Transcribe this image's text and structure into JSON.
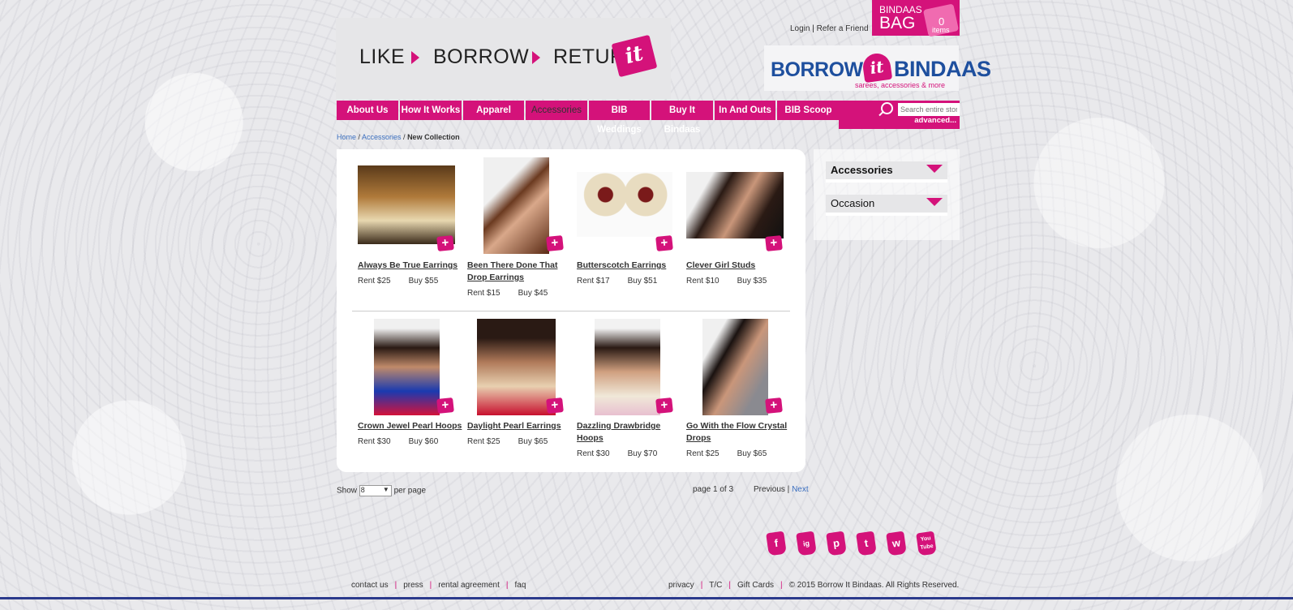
{
  "header": {
    "tagline": [
      "LIKE",
      "BORROW",
      "RETURN"
    ],
    "tagline_it": "it",
    "login": "Login",
    "refer": "Refer a Friend",
    "bag": {
      "line1": "BINDAAS",
      "line2": "BAG",
      "count": "0",
      "items_label": "items"
    },
    "brand": {
      "borrow": "BORROW",
      "it": "it",
      "bindaas": "BINDAAS",
      "sub": "sarees, accessories & more"
    }
  },
  "nav": {
    "items": [
      "About Us",
      "How It Works",
      "Apparel",
      "Accessories",
      "BIB Weddings",
      "Buy It Bindaas",
      "In And Outs",
      "BIB Scoop"
    ],
    "active": "Accessories"
  },
  "search": {
    "placeholder": "Search entire store here...",
    "advanced": "advanced..."
  },
  "breadcrumb": {
    "home": "Home",
    "accessories": "Accessories",
    "current": "New Collection"
  },
  "products": [
    {
      "name": "Always Be True Earrings",
      "rent": "Rent $25",
      "buy": "Buy $55"
    },
    {
      "name": "Been There Done That Drop Earrings",
      "rent": "Rent $15",
      "buy": "Buy $45"
    },
    {
      "name": "Butterscotch Earrings",
      "rent": "Rent $17",
      "buy": "Buy $51"
    },
    {
      "name": "Clever Girl Studs",
      "rent": "Rent $10",
      "buy": "Buy $35"
    },
    {
      "name": "Crown Jewel Pearl Hoops",
      "rent": "Rent $30",
      "buy": "Buy $60"
    },
    {
      "name": "Daylight Pearl Earrings",
      "rent": "Rent $25",
      "buy": "Buy $65"
    },
    {
      "name": "Dazzling Drawbridge Hoops",
      "rent": "Rent $30",
      "buy": "Buy $70"
    },
    {
      "name": "Go With the Flow Crystal Drops",
      "rent": "Rent $25",
      "buy": "Buy $65"
    }
  ],
  "sidebar": {
    "filters": [
      "Accessories",
      "Occasion"
    ]
  },
  "pager": {
    "show": "Show",
    "per_page_value": "8",
    "per_page": "per page",
    "page_info": "page 1 of 3",
    "previous": "Previous",
    "next": "Next"
  },
  "social": [
    "f",
    "ig",
    "p",
    "t",
    "w",
    "You Tube"
  ],
  "footer": {
    "left": [
      "contact us",
      "press",
      "rental agreement",
      "faq"
    ],
    "right": [
      "privacy",
      "T/C",
      "Gift Cards",
      "© 2015 Borrow It Bindaas. All Rights Reserved."
    ]
  },
  "colors": {
    "accent": "#d4127a",
    "brand_blue": "#1e4f9e",
    "link": "#3b6fbf"
  }
}
